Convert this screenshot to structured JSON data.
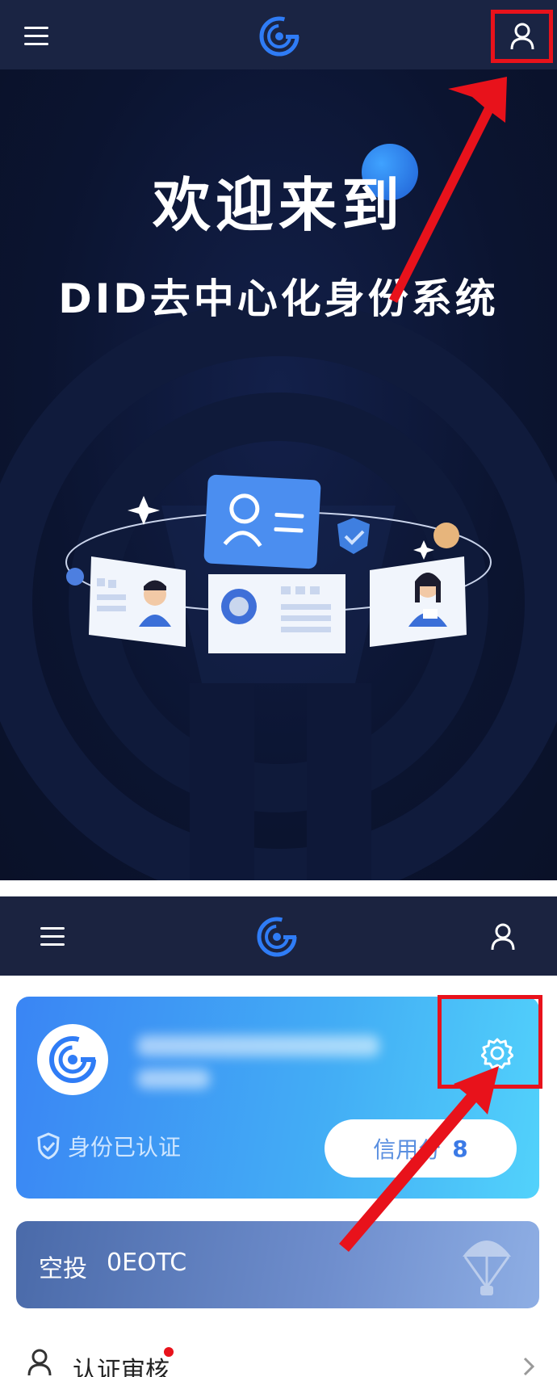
{
  "top_screen": {
    "title_line1": "欢迎来到",
    "title_line2": "DID去中心化身份系统",
    "icons": {
      "menu": "hamburger-menu-icon",
      "logo": "app-logo-icon",
      "user": "user-profile-icon"
    }
  },
  "bottom_screen": {
    "profile_card": {
      "verified_label": "身份已认证",
      "credit_label": "信用分",
      "credit_score": "8"
    },
    "airdrop": {
      "label": "空投",
      "value": "0EOTC"
    },
    "menu_items": [
      {
        "label": "认证审核",
        "has_badge": true
      }
    ],
    "icons": {
      "menu": "hamburger-menu-icon",
      "logo": "app-logo-icon",
      "user": "user-profile-icon",
      "settings": "gear-icon"
    }
  },
  "colors": {
    "highlight": "#e8121b",
    "brand_blue": "#2f7cf6",
    "navbar": "#1a2443"
  }
}
